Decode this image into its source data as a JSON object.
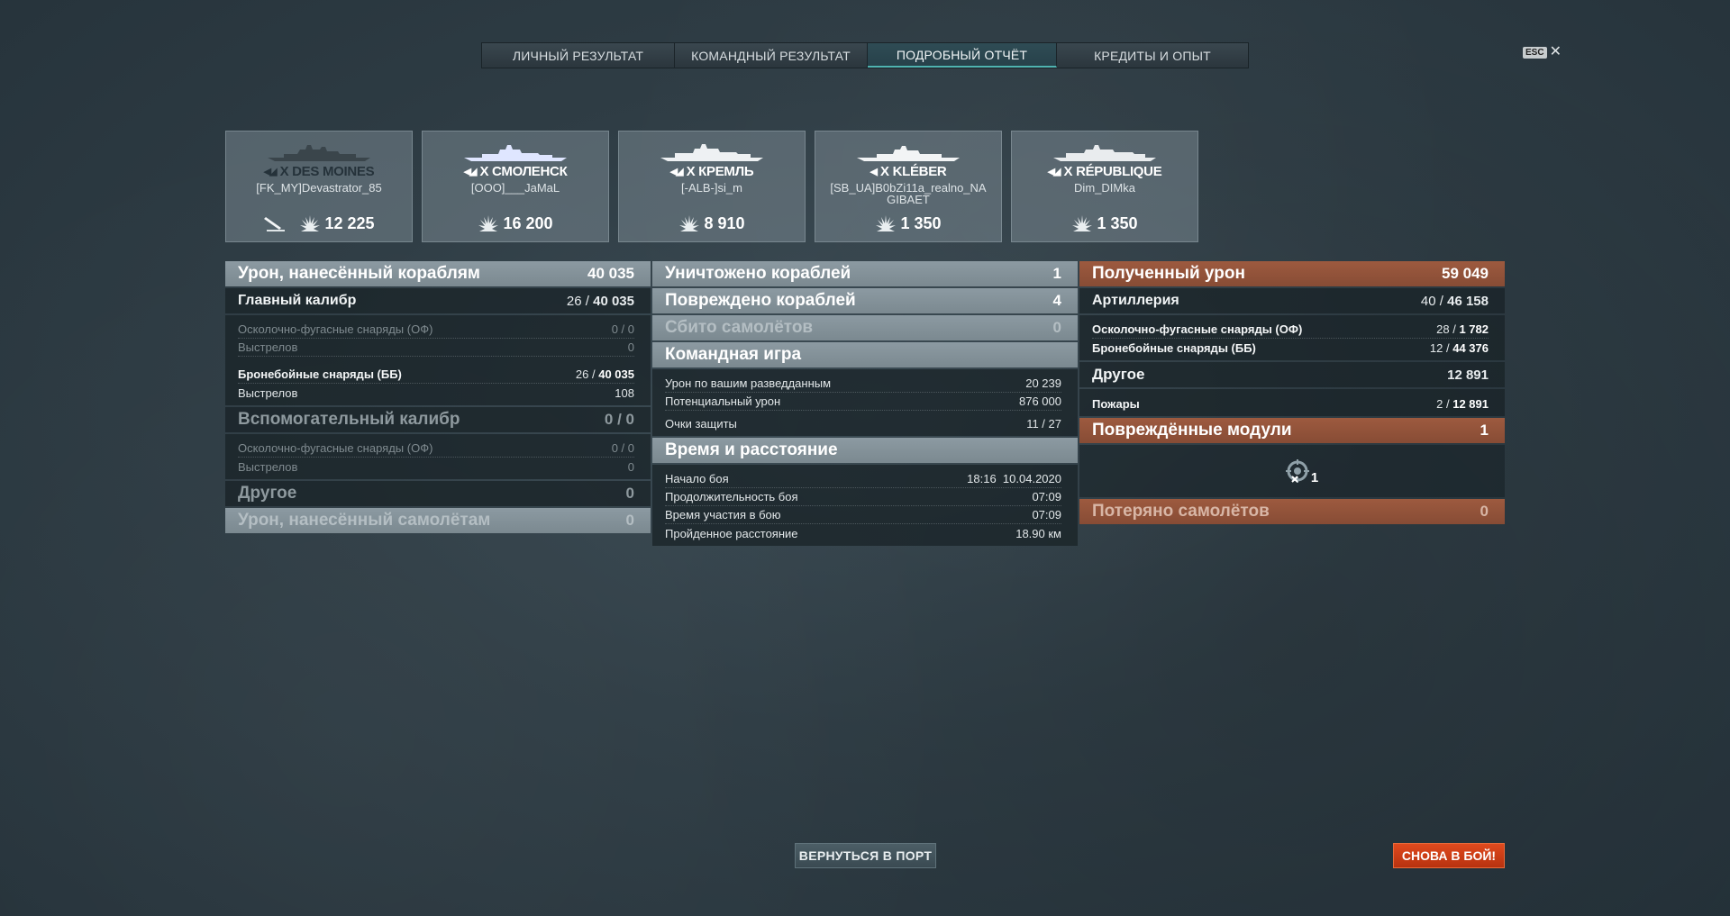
{
  "tabs": [
    {
      "label": "ЛИЧНЫЙ РЕЗУЛЬТАТ"
    },
    {
      "label": "КОМАНДНЫЙ РЕЗУЛЬТАТ"
    },
    {
      "label": "ПОДРОБНЫЙ ОТЧЁТ"
    },
    {
      "label": "КРЕДИТЫ И ОПЫТ"
    }
  ],
  "active_tab": "ПОДРОБНЫЙ ОТЧЁТ",
  "esc": {
    "key": "ESC",
    "close": "✕"
  },
  "ships": [
    {
      "name": "X DES MOINES",
      "player": "[FK_MY]Devastrator_85",
      "damage": "12 225",
      "icon": "cruiser-icon",
      "dark": true
    },
    {
      "name": "X СМОЛЕНСК",
      "player": "[OOO]___JaMaL",
      "damage": "16 200",
      "icon": "cruiser-icon"
    },
    {
      "name": "X КРЕМЛЬ",
      "player": "[-ALB-]si_m",
      "damage": "8 910",
      "icon": "battleship-icon"
    },
    {
      "name": "X KLÉBER",
      "player": "[SB_UA]B0bZi11a_realno_NAGIBAET",
      "damage": "1 350",
      "icon": "destroyer-icon"
    },
    {
      "name": "X RÉPUBLIQUE",
      "player": "Dim_DIMka",
      "damage": "1 350",
      "icon": "battleship-icon"
    }
  ],
  "col1": {
    "ship_damage": {
      "label": "Урон, нанесённый кораблям",
      "value": "40 035"
    },
    "main_battery": {
      "label": "Главный калибр",
      "hits": "26 /",
      "value": "40 035"
    },
    "mb_he": {
      "label": "Осколочно-фугасные снаряды (ОФ)",
      "value": "0 / 0"
    },
    "mb_he_shots": {
      "label": "Выстрелов",
      "value": "0"
    },
    "mb_ap": {
      "label": "Бронебойные снаряды (ББ)",
      "hits": "26 /",
      "value": "40 035"
    },
    "mb_ap_shots": {
      "label": "Выстрелов",
      "value": "108"
    },
    "secondary": {
      "label": "Вспомогательный калибр",
      "value": "0 / 0"
    },
    "sec_he": {
      "label": "Осколочно-фугасные снаряды (ОФ)",
      "value": "0 / 0"
    },
    "sec_he_shots": {
      "label": "Выстрелов",
      "value": "0"
    },
    "other": {
      "label": "Другое",
      "value": "0"
    },
    "plane_damage": {
      "label": "Урон, нанесённый самолётам",
      "value": "0"
    }
  },
  "col2": {
    "destroyed": {
      "label": "Уничтожено кораблей",
      "value": "1"
    },
    "damaged": {
      "label": "Повреждено кораблей",
      "value": "4"
    },
    "planes": {
      "label": "Сбито самолётов",
      "value": "0"
    },
    "team": {
      "label": "Командная игра"
    },
    "spotting": {
      "label": "Урон по вашим разведданным",
      "value": "20 239"
    },
    "potential": {
      "label": "Потенциальный урон",
      "value": "876 000"
    },
    "defense": {
      "label": "Очки защиты",
      "value": "11 / 27"
    },
    "time": {
      "label": "Время и расстояние"
    },
    "start": {
      "label": "Начало боя",
      "value": "18:16  10.04.2020"
    },
    "duration": {
      "label": "Продолжительность боя",
      "value": "07:09"
    },
    "participation": {
      "label": "Время участия в бою",
      "value": "07:09"
    },
    "distance": {
      "label": "Пройденное расстояние",
      "value": "18.90 км"
    }
  },
  "col3": {
    "received": {
      "label": "Полученный урон",
      "value": "59 049"
    },
    "artillery": {
      "label": "Артиллерия",
      "hits": "40 /",
      "value": "46 158"
    },
    "art_he": {
      "label": "Осколочно-фугасные снаряды (ОФ)",
      "hits": "28 /",
      "value": "1 782"
    },
    "art_ap": {
      "label": "Бронебойные снаряды (ББ)",
      "hits": "12 /",
      "value": "44 376"
    },
    "other": {
      "label": "Другое",
      "value": "12 891"
    },
    "fires": {
      "label": "Пожары",
      "hits": "2 /",
      "value": "12 891"
    },
    "modules": {
      "label": "Повреждённые модули",
      "value": "1"
    },
    "module_count": "1",
    "planes_lost": {
      "label": "Потеряно самолётов",
      "value": "0"
    }
  },
  "buttons": {
    "port": "ВЕРНУТЬСЯ В ПОРТ",
    "battle": "СНОВА В БОЙ!"
  },
  "colors": {
    "accent_orange": "#9d5a3f",
    "battle_red": "#d53f17",
    "tab_active": "#4fb3b0"
  }
}
